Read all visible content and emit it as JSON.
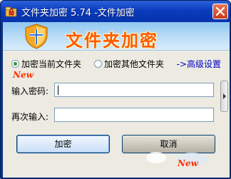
{
  "window": {
    "title": "文件夹加密 5.74 -文件加密",
    "app_icon": "folder-lock-icon",
    "close_icon": "close-icon"
  },
  "banner": {
    "title": "文件夹加密",
    "icon": "shield-icon"
  },
  "mode": {
    "options": [
      {
        "label": "加密当前文件夹",
        "checked": true
      },
      {
        "label": "加密其他文件夹",
        "checked": false
      }
    ],
    "advanced_link": "->高级设置"
  },
  "new_badge": "New",
  "form": {
    "password_label": "输入密码:",
    "password_value": "",
    "confirm_label": "再次输入:",
    "confirm_value": ""
  },
  "buttons": {
    "encrypt": "加密",
    "cancel": "取消"
  },
  "colors": {
    "title_bar": "#0a3cbf",
    "banner_text": "#ff5a00",
    "link": "#0000cc",
    "new_badge": "#ff3300"
  }
}
